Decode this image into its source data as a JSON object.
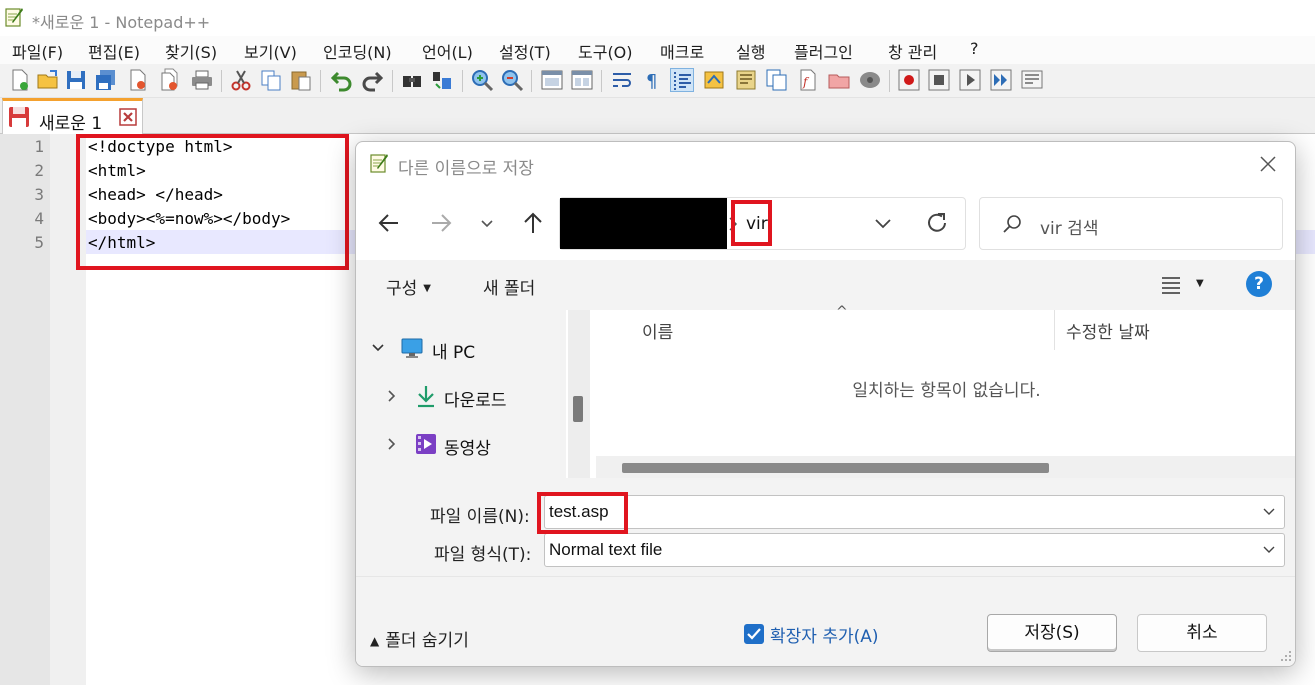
{
  "window": {
    "title": "*새로운 1 - Notepad++"
  },
  "menu": {
    "items": [
      "파일(F)",
      "편집(E)",
      "찾기(S)",
      "보기(V)",
      "인코딩(N)",
      "언어(L)",
      "설정(T)",
      "도구(O)",
      "매크로",
      "실행",
      "플러그인",
      "창 관리",
      "?"
    ]
  },
  "tab": {
    "label": "새로운 1"
  },
  "editor": {
    "line_numbers": [
      "1",
      "2",
      "3",
      "4",
      "5"
    ],
    "lines": [
      "<!doctype html>",
      "<html>",
      "<head> </head>",
      "<body><%=now%></body>",
      "</html>"
    ]
  },
  "dialog": {
    "title": "다른 이름으로 저장",
    "address_crumb": "vir",
    "search_placeholder": "vir 검색",
    "organize_label": "구성",
    "new_folder_label": "새 폴더",
    "tree": {
      "this_pc": "내 PC",
      "downloads": "다운로드",
      "videos": "동영상"
    },
    "columns": {
      "name": "이름",
      "modified": "수정한 날짜"
    },
    "empty_message": "일치하는 항목이 없습니다.",
    "filename_label": "파일 이름(N):",
    "filename_value": "test.asp",
    "filetype_label": "파일 형식(T):",
    "filetype_value": "Normal text file",
    "hide_folders_label": "폴더 숨기기",
    "extension_label": "확장자 추가(A)",
    "extension_checked": true,
    "save_label": "저장(S)",
    "cancel_label": "취소"
  },
  "colors": {
    "highlight_box": "#e0151f",
    "tab_accent": "#f4a12f",
    "checkbox": "#1f6fc8",
    "help": "#1f7fd6"
  }
}
